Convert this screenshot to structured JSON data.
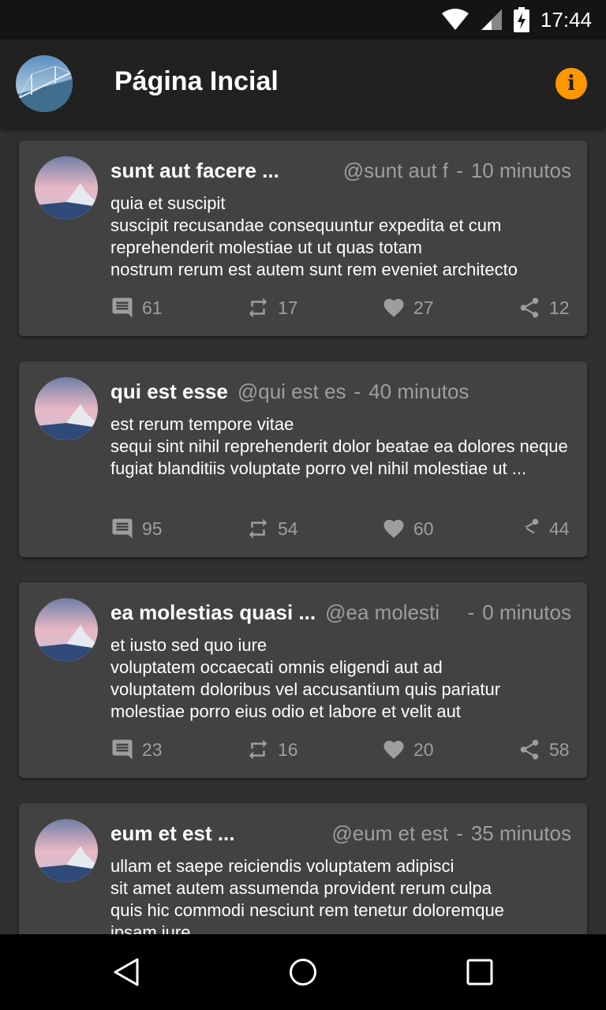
{
  "status_bar": {
    "time": "17:44"
  },
  "app_bar": {
    "title": "Página Incial"
  },
  "posts": [
    {
      "title": "sunt aut facere ...",
      "handle": "@sunt aut f",
      "separator": "-",
      "time": "10 minutos",
      "body": [
        "quia et suscipit",
        "suscipit recusandae consequuntur expedita et cum",
        "reprehenderit molestiae ut ut quas totam",
        "nostrum rerum est autem sunt rem eveniet architecto"
      ],
      "comments": "61",
      "retweets": "17",
      "likes": "27",
      "shares": "12"
    },
    {
      "title": "qui est esse",
      "handle": "@qui est es",
      "separator": "-",
      "time": "40 minutos",
      "body": [
        "est rerum tempore vitae",
        "sequi sint nihil reprehenderit dolor beatae ea dolores neque",
        "fugiat blanditiis voluptate porro vel nihil molestiae ut ..."
      ],
      "comments": "95",
      "retweets": "54",
      "likes": "60",
      "shares": "44"
    },
    {
      "title": "ea molestias quasi ...",
      "handle": "@ea molesti",
      "separator": "-",
      "time": "0 minutos",
      "body": [
        "et iusto sed quo iure",
        "voluptatem occaecati omnis eligendi aut ad",
        "voluptatem doloribus vel accusantium quis pariatur",
        "molestiae porro eius odio et labore et velit aut"
      ],
      "comments": "23",
      "retweets": "16",
      "likes": "20",
      "shares": "58"
    },
    {
      "title": "eum et est ...",
      "handle": "@eum et est",
      "separator": "-",
      "time": "35 minutos",
      "body": [
        "ullam et saepe reiciendis voluptatem adipisci",
        "sit amet autem assumenda provident rerum culpa",
        "quis hic commodi nesciunt rem tenetur doloremque",
        "ipsam iure"
      ],
      "comments": "",
      "retweets": "",
      "likes": "",
      "shares": ""
    }
  ],
  "icons": {
    "wifi": "wifi-icon",
    "signal": "signal-icon",
    "battery": "battery-charging-icon",
    "info": "info-icon",
    "comment": "comment-icon",
    "retweet": "retweet-icon",
    "like": "heart-icon",
    "share": "share-icon",
    "back": "back-icon",
    "home": "home-icon",
    "recents": "recents-icon"
  },
  "colors": {
    "accent": "#ff9800",
    "card": "#424242",
    "background": "#303030",
    "appbar": "#212121",
    "muted": "#9e9e9e"
  }
}
